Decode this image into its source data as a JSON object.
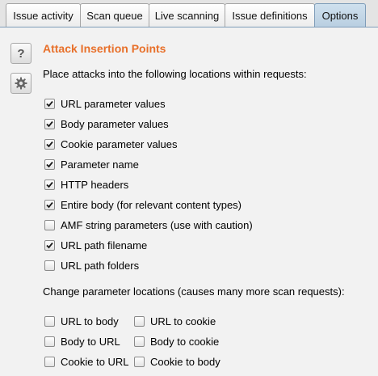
{
  "tabs": [
    {
      "label": "Issue activity",
      "active": false
    },
    {
      "label": "Scan queue",
      "active": false
    },
    {
      "label": "Live scanning",
      "active": false
    },
    {
      "label": "Issue definitions",
      "active": false
    },
    {
      "label": "Options",
      "active": true
    }
  ],
  "side_buttons": {
    "help_label": "?"
  },
  "section": {
    "title": "Attack Insertion Points",
    "description": "Place attacks into the following locations within requests:",
    "locations": [
      {
        "label": "URL parameter values",
        "checked": true
      },
      {
        "label": "Body parameter values",
        "checked": true
      },
      {
        "label": "Cookie parameter values",
        "checked": true
      },
      {
        "label": "Parameter name",
        "checked": true
      },
      {
        "label": "HTTP headers",
        "checked": true
      },
      {
        "label": "Entire body (for relevant content types)",
        "checked": true
      },
      {
        "label": "AMF string parameters (use with caution)",
        "checked": false
      },
      {
        "label": "URL path filename",
        "checked": true
      },
      {
        "label": "URL path folders",
        "checked": false
      }
    ],
    "change_description": "Change parameter locations (causes many more scan requests):",
    "change_options": [
      {
        "label": "URL to body",
        "checked": false
      },
      {
        "label": "URL to cookie",
        "checked": false
      },
      {
        "label": "Body to URL",
        "checked": false
      },
      {
        "label": "Body to cookie",
        "checked": false
      },
      {
        "label": "Cookie to URL",
        "checked": false
      },
      {
        "label": "Cookie to body",
        "checked": false
      }
    ]
  },
  "colors": {
    "title": "#e8702a",
    "active_tab": "#b9cfe1",
    "background": "#f2f2f2"
  }
}
